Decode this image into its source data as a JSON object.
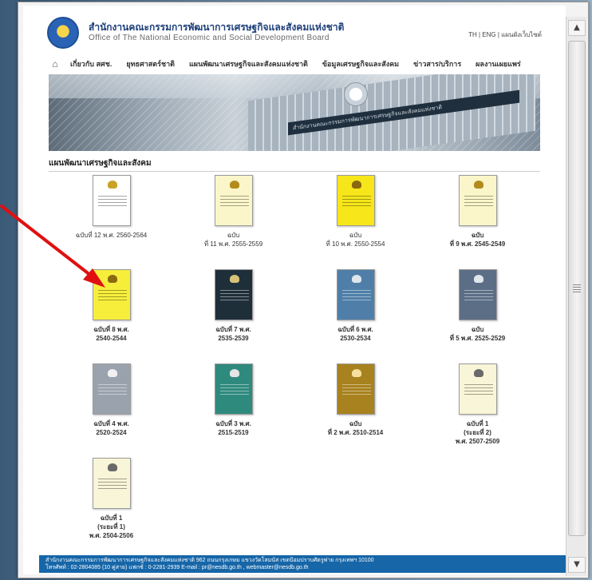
{
  "header": {
    "org_name_th": "สำนักงานคณะกรรมการพัฒนาการเศรษฐกิจและสังคมแห่งชาติ",
    "org_name_en": "Office of The National Economic and Social Development Board",
    "lang_links": "TH | ENG | แผนผังเว็บไซต์"
  },
  "nav": {
    "items": [
      "เกี่ยวกับ สศช.",
      "ยุทธศาสตร์ชาติ",
      "แผนพัฒนาเศรษฐกิจและสังคมแห่งชาติ",
      "ข้อมูลเศรษฐกิจและสังคม",
      "ข่าวสาร/บริการ",
      "ผลงานเผยแพร่"
    ]
  },
  "banner": {
    "sign_text": "สำนักงานคณะกรรมการพัฒนาการเศรษฐกิจและสังคมแห่งชาติ"
  },
  "section": {
    "title": "แผนพัฒนาเศรษฐกิจและสังคม"
  },
  "books": [
    {
      "label": "ฉบับที่ 12 พ.ศ. 2560-2564",
      "cover": "#ffffff",
      "emblem": "#c9a227",
      "bold": false,
      "dark": false
    },
    {
      "label": "ฉบับ\nที่ 11 พ.ศ. 2555-2559",
      "cover": "#fbf6c9",
      "emblem": "#b38b1d",
      "bold": false,
      "dark": false
    },
    {
      "label": "ฉบับ\nที่ 10 พ.ศ. 2550-2554",
      "cover": "#f6e61a",
      "emblem": "#8a6a10",
      "bold": false,
      "dark": false
    },
    {
      "label": "ฉบับ\nที่ 9 พ.ศ. 2545-2549",
      "cover": "#fbf6c9",
      "emblem": "#b38b1d",
      "bold": true,
      "dark": false
    },
    {
      "label": "ฉบับที่ 8 พ.ศ.\n2540-2544",
      "cover": "#f7ee3c",
      "emblem": "#8a6a10",
      "bold": true,
      "dark": false
    },
    {
      "label": "ฉบับที่ 7 พ.ศ.\n2535-2539",
      "cover": "#1f2f3a",
      "emblem": "#d8c27a",
      "bold": true,
      "dark": true
    },
    {
      "label": "ฉบับที่ 6 พ.ศ.\n2530-2534",
      "cover": "#4f7fa8",
      "emblem": "#dfe6ec",
      "bold": true,
      "dark": true
    },
    {
      "label": "ฉบับ\nที่ 5 พ.ศ. 2525-2529",
      "cover": "#5c6e86",
      "emblem": "#dfe6ec",
      "bold": true,
      "dark": true
    },
    {
      "label": "ฉบับที่ 4 พ.ศ.\n2520-2524",
      "cover": "#9aa3ad",
      "emblem": "#f1f1f1",
      "bold": true,
      "dark": true
    },
    {
      "label": "ฉบับที่ 3 พ.ศ.\n2515-2519",
      "cover": "#2f8a7e",
      "emblem": "#e5e5e5",
      "bold": true,
      "dark": true
    },
    {
      "label": "ฉบับ\nที่ 2 พ.ศ. 2510-2514",
      "cover": "#a8821e",
      "emblem": "#f5e0a0",
      "bold": true,
      "dark": true
    },
    {
      "label": "ฉบับที่ 1\n(ระยะที่ 2)\nพ.ศ. 2507-2509",
      "cover": "#f8f5d8",
      "emblem": "#6a6a6a",
      "bold": true,
      "dark": false
    },
    {
      "label": "ฉบับที่ 1\n(ระยะที่ 1)\nพ.ศ. 2504-2506",
      "cover": "#f8f5d8",
      "emblem": "#6a6a6a",
      "bold": true,
      "dark": false
    }
  ],
  "footer": {
    "line1": "สำนักงานคณะกรรมการพัฒนาการเศรษฐกิจและสังคมแห่งชาติ 962 ถนนกรุงเกษม แขวงวัดโสมนัส เขตป้อมปราบศัตรูพ่าย กรุงเทพฯ 10100",
    "line2": "โทรศัพท์ : 02-2804085 (10 คู่สาย) แฟกซ์ : 0-2281-2939 E-mail : pr@nesdb.go.th , webmaster@nesdb.go.th"
  },
  "colors": {
    "footer_bg": "#1666a8",
    "annotation_arrow": "#e01010"
  }
}
